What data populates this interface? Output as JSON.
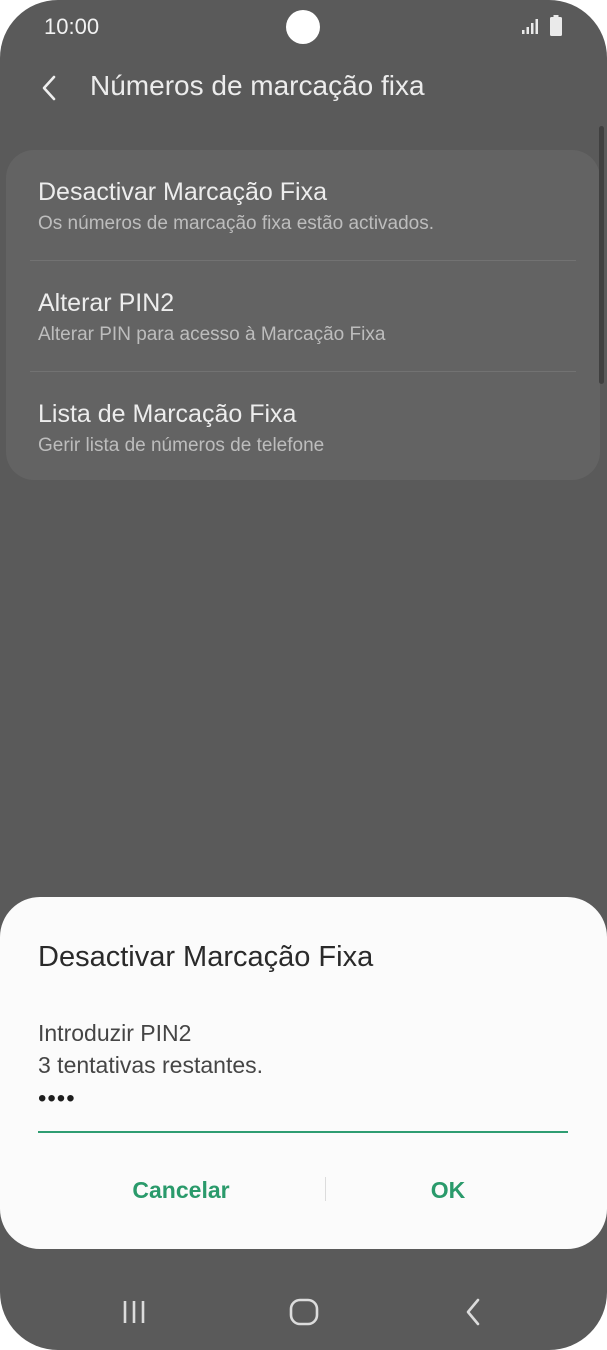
{
  "status_bar": {
    "time": "10:00",
    "icons": [
      "signal-icon",
      "battery-icon"
    ]
  },
  "header": {
    "back_icon": "chevron-left-icon",
    "title": "Números de marcação fixa"
  },
  "settings": {
    "items": [
      {
        "title": "Desactivar Marcação Fixa",
        "subtitle": "Os números de marcação fixa estão activados."
      },
      {
        "title": "Alterar PIN2",
        "subtitle": "Alterar PIN para acesso à Marcação Fixa"
      },
      {
        "title": "Lista de Marcação Fixa",
        "subtitle": "Gerir lista de números de telefone"
      }
    ]
  },
  "dialog": {
    "title": "Desactivar Marcação Fixa",
    "prompt": "Introduzir PIN2",
    "attempts": "3 tentativas restantes.",
    "pin_value": "••••",
    "cancel_label": "Cancelar",
    "ok_label": "OK"
  },
  "nav_bar": {
    "icons": [
      "recent-apps-icon",
      "home-icon",
      "back-icon"
    ]
  },
  "colors": {
    "accent": "#2a9a6b",
    "overlay": "#5a5a5a",
    "dialog_bg": "#fbfbfb"
  }
}
